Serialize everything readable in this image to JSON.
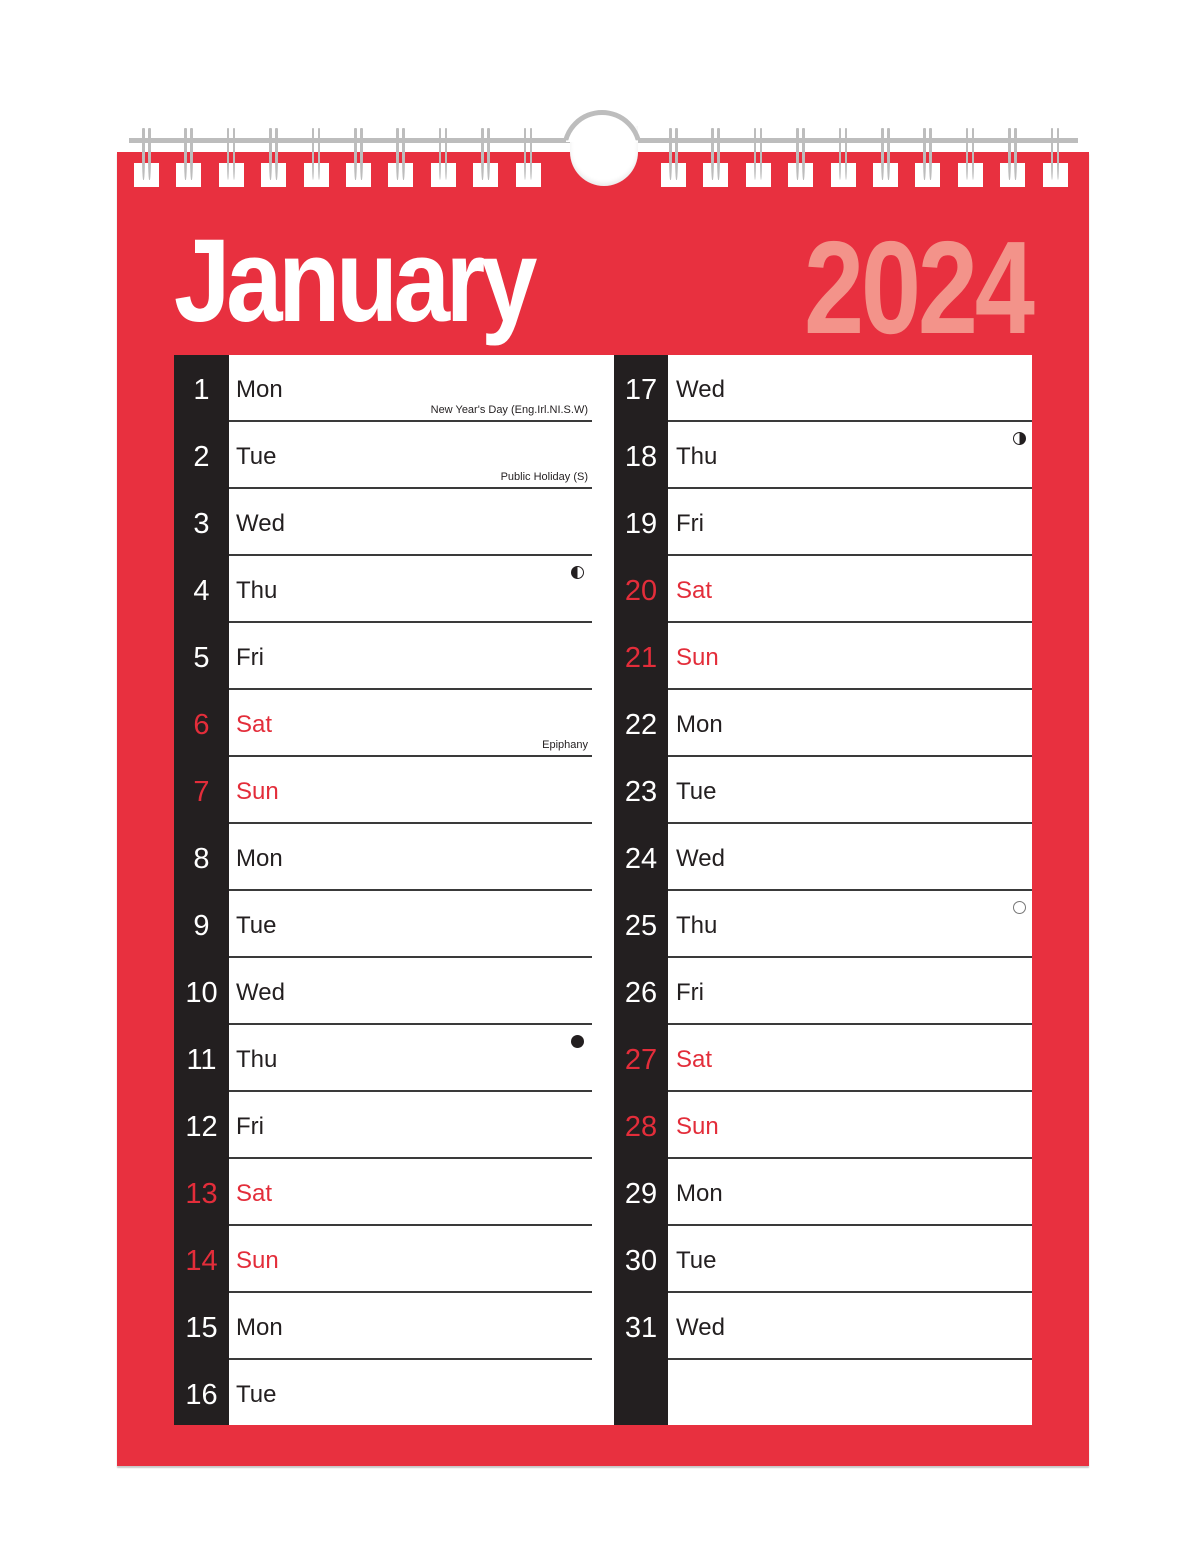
{
  "calendar": {
    "month": "January",
    "year": "2024",
    "colors": {
      "page_red": "#e8303f",
      "weekend_red": "#e32d3a",
      "year_salmon": "#f3938a",
      "number_bar": "#231f20",
      "wire_gray": "#bdbdbd"
    },
    "left_column": [
      {
        "day": "1",
        "name": "Mon",
        "note": "New Year's Day (Eng.Irl.NI.S.W)",
        "weekend": false,
        "moon": null
      },
      {
        "day": "2",
        "name": "Tue",
        "note": "Public Holiday (S)",
        "weekend": false,
        "moon": null
      },
      {
        "day": "3",
        "name": "Wed",
        "note": null,
        "weekend": false,
        "moon": null
      },
      {
        "day": "4",
        "name": "Thu",
        "note": null,
        "weekend": false,
        "moon": "last-quarter-moon"
      },
      {
        "day": "5",
        "name": "Fri",
        "note": null,
        "weekend": false,
        "moon": null
      },
      {
        "day": "6",
        "name": "Sat",
        "note": "Epiphany",
        "weekend": true,
        "moon": null
      },
      {
        "day": "7",
        "name": "Sun",
        "note": null,
        "weekend": true,
        "moon": null
      },
      {
        "day": "8",
        "name": "Mon",
        "note": null,
        "weekend": false,
        "moon": null
      },
      {
        "day": "9",
        "name": "Tue",
        "note": null,
        "weekend": false,
        "moon": null
      },
      {
        "day": "10",
        "name": "Wed",
        "note": null,
        "weekend": false,
        "moon": null
      },
      {
        "day": "11",
        "name": "Thu",
        "note": null,
        "weekend": false,
        "moon": "new-moon"
      },
      {
        "day": "12",
        "name": "Fri",
        "note": null,
        "weekend": false,
        "moon": null
      },
      {
        "day": "13",
        "name": "Sat",
        "note": null,
        "weekend": true,
        "moon": null
      },
      {
        "day": "14",
        "name": "Sun",
        "note": null,
        "weekend": true,
        "moon": null
      },
      {
        "day": "15",
        "name": "Mon",
        "note": null,
        "weekend": false,
        "moon": null
      },
      {
        "day": "16",
        "name": "Tue",
        "note": null,
        "weekend": false,
        "moon": null
      }
    ],
    "right_column": [
      {
        "day": "17",
        "name": "Wed",
        "note": null,
        "weekend": false,
        "moon": null
      },
      {
        "day": "18",
        "name": "Thu",
        "note": null,
        "weekend": false,
        "moon": "first-quarter-moon"
      },
      {
        "day": "19",
        "name": "Fri",
        "note": null,
        "weekend": false,
        "moon": null
      },
      {
        "day": "20",
        "name": "Sat",
        "note": null,
        "weekend": true,
        "moon": null
      },
      {
        "day": "21",
        "name": "Sun",
        "note": null,
        "weekend": true,
        "moon": null
      },
      {
        "day": "22",
        "name": "Mon",
        "note": null,
        "weekend": false,
        "moon": null
      },
      {
        "day": "23",
        "name": "Tue",
        "note": null,
        "weekend": false,
        "moon": null
      },
      {
        "day": "24",
        "name": "Wed",
        "note": null,
        "weekend": false,
        "moon": null
      },
      {
        "day": "25",
        "name": "Thu",
        "note": null,
        "weekend": false,
        "moon": "full-moon"
      },
      {
        "day": "26",
        "name": "Fri",
        "note": null,
        "weekend": false,
        "moon": null
      },
      {
        "day": "27",
        "name": "Sat",
        "note": null,
        "weekend": true,
        "moon": null
      },
      {
        "day": "28",
        "name": "Sun",
        "note": null,
        "weekend": true,
        "moon": null
      },
      {
        "day": "29",
        "name": "Mon",
        "note": null,
        "weekend": false,
        "moon": null
      },
      {
        "day": "30",
        "name": "Tue",
        "note": null,
        "weekend": false,
        "moon": null
      },
      {
        "day": "31",
        "name": "Wed",
        "note": null,
        "weekend": false,
        "moon": null
      },
      {
        "day": null,
        "name": null,
        "note": null,
        "weekend": false,
        "moon": null
      }
    ]
  }
}
